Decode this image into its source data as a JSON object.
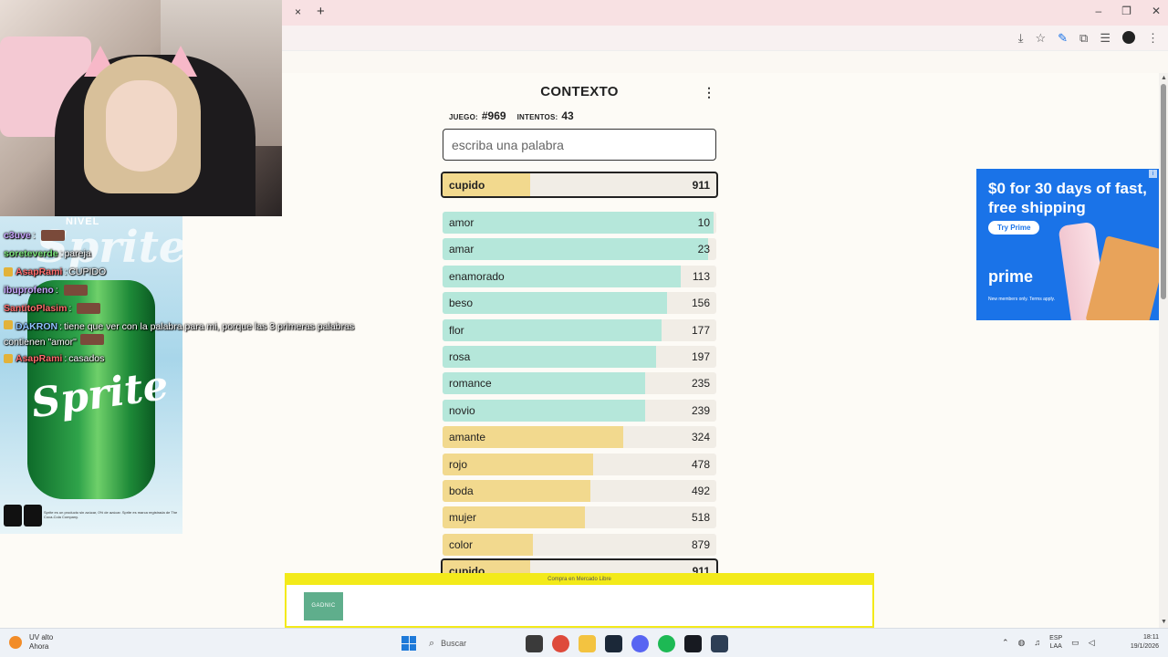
{
  "browser": {
    "tab_close": "×",
    "new_tab": "+",
    "window_controls": [
      "–",
      "❐",
      "✕"
    ],
    "toolbar_icons": [
      "install-icon",
      "star-icon",
      "translate-icon",
      "extensions-icon",
      "reading-list-icon",
      "profile-icon",
      "menu-icon"
    ],
    "toolbar_glyphs": [
      "⤓",
      "☆",
      "✎",
      "⧉",
      "☰",
      "",
      "⋮"
    ]
  },
  "game": {
    "title": "CONTEXTO",
    "menu_glyph": "⋮",
    "game_label": "JUEGO:",
    "game_number": "#969",
    "attempts_label": "INTENTOS:",
    "attempts_value": "43",
    "input_placeholder": "escriba una palabra",
    "last_guess": {
      "word": "cupido",
      "rank": "911",
      "fill": 0.32,
      "color": "#f2d98e"
    },
    "guesses": [
      {
        "word": "amor",
        "rank": "10",
        "fill": 0.99,
        "color": "#b5e7da"
      },
      {
        "word": "amar",
        "rank": "23",
        "fill": 0.97,
        "color": "#b5e7da"
      },
      {
        "word": "enamorado",
        "rank": "113",
        "fill": 0.87,
        "color": "#b5e7da"
      },
      {
        "word": "beso",
        "rank": "156",
        "fill": 0.82,
        "color": "#b5e7da"
      },
      {
        "word": "flor",
        "rank": "177",
        "fill": 0.8,
        "color": "#b5e7da"
      },
      {
        "word": "rosa",
        "rank": "197",
        "fill": 0.78,
        "color": "#b5e7da"
      },
      {
        "word": "romance",
        "rank": "235",
        "fill": 0.74,
        "color": "#b5e7da"
      },
      {
        "word": "novio",
        "rank": "239",
        "fill": 0.74,
        "color": "#b5e7da"
      },
      {
        "word": "amante",
        "rank": "324",
        "fill": 0.66,
        "color": "#f2d98e"
      },
      {
        "word": "rojo",
        "rank": "478",
        "fill": 0.55,
        "color": "#f2d98e"
      },
      {
        "word": "boda",
        "rank": "492",
        "fill": 0.54,
        "color": "#f2d98e"
      },
      {
        "word": "mujer",
        "rank": "518",
        "fill": 0.52,
        "color": "#f2d98e"
      },
      {
        "word": "color",
        "rank": "879",
        "fill": 0.33,
        "color": "#f2d98e"
      }
    ],
    "bottom_guess": {
      "word": "cupido",
      "rank": "911"
    }
  },
  "stream": {
    "side_ad": {
      "level_text": "NIVEL",
      "brand": "Sprite",
      "legal": "Sprite es un producto sin azúcar, 0% de azúcar. Sprite es marca registrada de The Coca-Cola Company."
    },
    "chat": [
      {
        "user": "c3uve",
        "sep": ":",
        "text": "",
        "color": "u-purple",
        "badge": false,
        "emote": true
      },
      {
        "user": "soreteverde",
        "sep": ":",
        "text": "pareja",
        "color": "u-green",
        "badge": false,
        "emote": false
      },
      {
        "user": "AsapRami",
        "sep": ":",
        "text": "CUPIDO",
        "color": "u-red",
        "badge": true,
        "emote": false
      },
      {
        "user": "ibuprofeno",
        "sep": ":",
        "text": "",
        "color": "u-purple",
        "badge": false,
        "emote": true
      },
      {
        "user": "SantitoPlasim",
        "sep": ":",
        "text": "",
        "color": "u-red",
        "badge": false,
        "emote": true
      },
      {
        "user": "DAKRON",
        "sep": ":",
        "text": "tiene que ver con la palabra para mi, porque las 3 primeras palabras contienen \"amor\"",
        "color": "u-blue",
        "badge": true,
        "emote": true,
        "wrap": true
      },
      {
        "user": "AsapRami",
        "sep": ":",
        "text": "casados",
        "color": "u-red",
        "badge": true,
        "emote": false
      }
    ]
  },
  "amazon_ad": {
    "headline": "$0 for 30 days of fast, free shipping",
    "cta": "Try Prime",
    "brand": "prime",
    "sub": "New members only. Terms apply."
  },
  "banner_ad": {
    "strip": "Compra en Mercado Libre",
    "logo": "GADNIC"
  },
  "taskbar": {
    "weather_line1": "UV alto",
    "weather_line2": "Ahora",
    "search_label": "Buscar",
    "apps": [
      "files-icon",
      "chrome-icon",
      "folder-icon",
      "steam-alt-icon",
      "discord-icon",
      "spotify-icon",
      "steam-icon",
      "app-icon"
    ],
    "app_colors": [
      "#3a3a3a",
      "#de4a3b",
      "#f3c340",
      "#1b2838",
      "#5865f2",
      "#1db954",
      "#171a21",
      "#2d3e55"
    ],
    "lang_line1": "ESP",
    "lang_line2": "LAA",
    "time": "18:11",
    "date": "19/1/2026"
  }
}
